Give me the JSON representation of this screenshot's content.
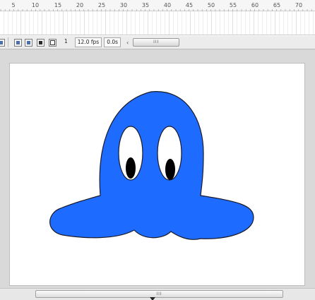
{
  "timeline": {
    "ruler_labels": [
      "5",
      "10",
      "15",
      "20",
      "25",
      "30",
      "35",
      "40",
      "45",
      "50",
      "55",
      "60",
      "65",
      "70"
    ]
  },
  "toolbar": {
    "current_frame": "1",
    "frame_rate": "12.0 fps",
    "elapsed_time": "0.0s",
    "icons": [
      "center-frame-icon",
      "onion-skin-icon",
      "onion-skin-outlines-icon",
      "edit-multiple-frames-icon",
      "modify-onion-markers-icon"
    ],
    "scroll_grip": "III"
  },
  "stage": {
    "shape_fill": "#1e6cff",
    "shape_stroke": "#1a1a2a",
    "eye_white": "#ffffff",
    "pupil": "#000000",
    "background": "#ffffff"
  },
  "hscroll": {
    "grip": "III"
  }
}
